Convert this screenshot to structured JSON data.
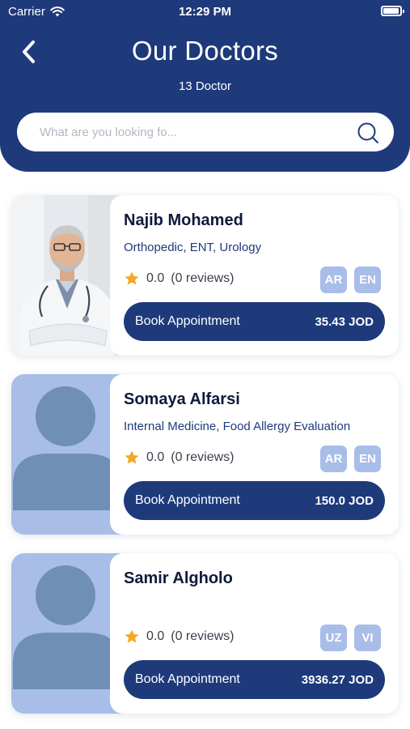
{
  "status_bar": {
    "carrier": "Carrier",
    "time": "12:29 PM"
  },
  "header": {
    "back_icon": "chevron-left-icon",
    "title": "Our Doctors",
    "count_text": "13 Doctor"
  },
  "search": {
    "placeholder": "What are you looking fo...",
    "value": "",
    "icon": "search-icon"
  },
  "colors": {
    "primary": "#1e3a7b",
    "accent_light": "#a8bde8",
    "star": "#f5a623"
  },
  "doctors": [
    {
      "name": "Najib Mohamed",
      "specialties": "Orthopedic, ENT, Urology",
      "rating": "0.0",
      "reviews": "(0 reviews)",
      "languages": [
        "AR",
        "EN"
      ],
      "book_label": "Book Appointment",
      "price": "35.43 JOD",
      "photo": "doctor-photo"
    },
    {
      "name": "Somaya Alfarsi",
      "specialties": "Internal Medicine, Food Allergy Evaluation",
      "rating": "0.0",
      "reviews": "(0 reviews)",
      "languages": [
        "AR",
        "EN"
      ],
      "book_label": "Book Appointment",
      "price": "150.0 JOD",
      "photo": "avatar-placeholder"
    },
    {
      "name": "Samir Algholo",
      "specialties": "",
      "rating": "0.0",
      "reviews": "(0 reviews)",
      "languages": [
        "UZ",
        "VI"
      ],
      "book_label": "Book Appointment",
      "price": "3936.27 JOD",
      "photo": "avatar-placeholder"
    }
  ]
}
